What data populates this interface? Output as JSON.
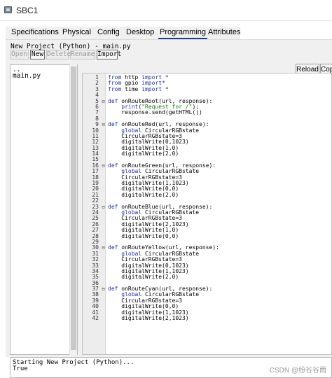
{
  "window": {
    "title": "SBC1",
    "icon": "device-icon"
  },
  "tabs": [
    "Specifications",
    "Physical",
    "Config",
    "Desktop",
    "Programming",
    "Attributes"
  ],
  "active_tab": "Programming",
  "project": {
    "label": "New Project (Python) - main.py",
    "buttons": [
      {
        "label": "Open",
        "state": "disabled"
      },
      {
        "label": "New",
        "state": "enabled"
      },
      {
        "label": "Delete",
        "state": "disabled"
      },
      {
        "label": "Rename",
        "state": "disabled"
      },
      {
        "label": "Import",
        "state": "enabled"
      }
    ]
  },
  "files": {
    "items": [
      "..",
      "main.py"
    ]
  },
  "editor_buttons": {
    "reload": "Reload",
    "copy": "Cop"
  },
  "editor": {
    "lines": [
      "from http import *",
      "from gpio import*",
      "from time import *",
      "",
      "def onRouteRoot(url, response):",
      "    print(\"Request for /\");",
      "    response.send(getHTML())",
      "",
      "def onRouteRed(url, response):",
      "    global CircularRGBstate",
      "    CircularRGBstate=3",
      "    digitalWrite(0,1023)",
      "    digitalWrite(1,0)",
      "    digitalWrite(2,0)",
      "",
      "def onRouteGreen(url, response):",
      "    global CircularRGBstate",
      "    CircularRGBstate=3",
      "    digitalWrite(1,1023)",
      "    digitalWrite(0,0)",
      "    digitalWrite(2,0)",
      "",
      "def onRouteBlue(url, response):",
      "    global CircularRGBstate",
      "    CircularRGBstate=3",
      "    digitalWrite(2,1023)",
      "    digitalWrite(1,0)",
      "    digitalWrite(0,0)",
      "",
      "def onRouteYellow(url, response):",
      "    global CircularRGBstate",
      "    CircularRGBstate=3",
      "    digitalWrite(0,1023)",
      "    digitalWrite(1,1023)",
      "    digitalWrite(2,0)",
      "",
      "def onRouteCyan(url, response):",
      "    global CircularRGBstate",
      "    CircularRGBstate=3",
      "    digitalWrite(0,0)",
      "    digitalWrite(1,1023)",
      "    digitalWrite(2,1023)"
    ]
  },
  "console": {
    "lines": [
      "Starting New Project (Python)...",
      "True"
    ]
  },
  "watermark": "CSDN @纷谷谷雨",
  "colors": {
    "keyword": "#1f2fb0",
    "string": "#1a7a1a",
    "active_tab_underline": "#1a3f8f"
  }
}
